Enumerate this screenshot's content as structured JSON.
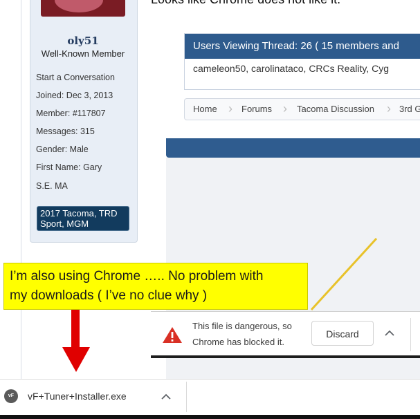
{
  "post_text": "Looks like Chrome does not like it.",
  "user": {
    "name": "oly51",
    "title": "Well-Known Member",
    "start_conversation": "Start a Conversation",
    "joined_label": "Joined:",
    "joined": "Dec 3, 2013",
    "member_label": "Member:",
    "member": "#117807",
    "messages_label": "Messages:",
    "messages": "315",
    "gender_label": "Gender:",
    "gender": "Male",
    "firstname_label": "First Name:",
    "firstname": "Gary",
    "location": "S.E. MA",
    "vehicle_line1": "2017 Tacoma, TRD",
    "vehicle_line2": "Sport, MGM"
  },
  "viewing": {
    "header": "Users Viewing Thread: 26 ( 15 members and",
    "users": "cameleon50, carolinataco, CRCs Reality, Cyg"
  },
  "breadcrumb": [
    "Home",
    "Forums",
    "Tacoma Discussion",
    "3rd G"
  ],
  "annotation": {
    "line1": "I’m also using Chrome ….. No problem with",
    "line2": " my downloads ( I’ve no clue why )"
  },
  "download_warning": {
    "line1": "This file is dangerous, so",
    "line2": "Chrome has blocked it.",
    "discard": "Discard"
  },
  "download_shelf": {
    "filename": "vF+Tuner+Installer.exe",
    "icon_text": "vF"
  },
  "colors": {
    "accent_blue": "#2e5b8d",
    "annotation_yellow": "#ffff00",
    "arrow_red": "#e00000",
    "warning_red": "#d93025"
  }
}
